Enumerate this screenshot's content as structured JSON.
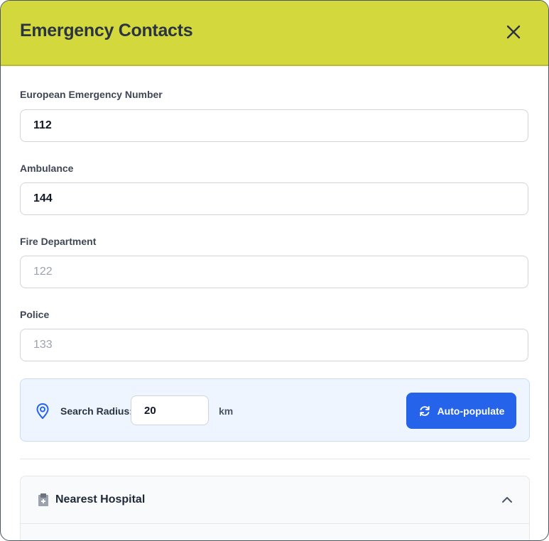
{
  "dialog": {
    "title": "Emergency Contacts",
    "close_icon": "close-icon"
  },
  "fields": {
    "european": {
      "label": "European Emergency Number",
      "value": "112",
      "placeholder": ""
    },
    "ambulance": {
      "label": "Ambulance",
      "value": "144",
      "placeholder": ""
    },
    "fire": {
      "label": "Fire Department",
      "value": "",
      "placeholder": "122"
    },
    "police": {
      "label": "Police",
      "value": "",
      "placeholder": "133"
    }
  },
  "search": {
    "icon": "map-pin-icon",
    "label": "Search Radius:",
    "value": "20",
    "unit": "km",
    "button_label": "Auto-populate",
    "button_icon": "refresh-icon"
  },
  "hospital": {
    "icon": "hospital-icon",
    "title": "Nearest Hospital",
    "toggle_icon": "chevron-up-icon"
  },
  "colors": {
    "header_bg": "#d3d93d",
    "accent": "#2563eb",
    "search_bg": "#eef5fe"
  }
}
